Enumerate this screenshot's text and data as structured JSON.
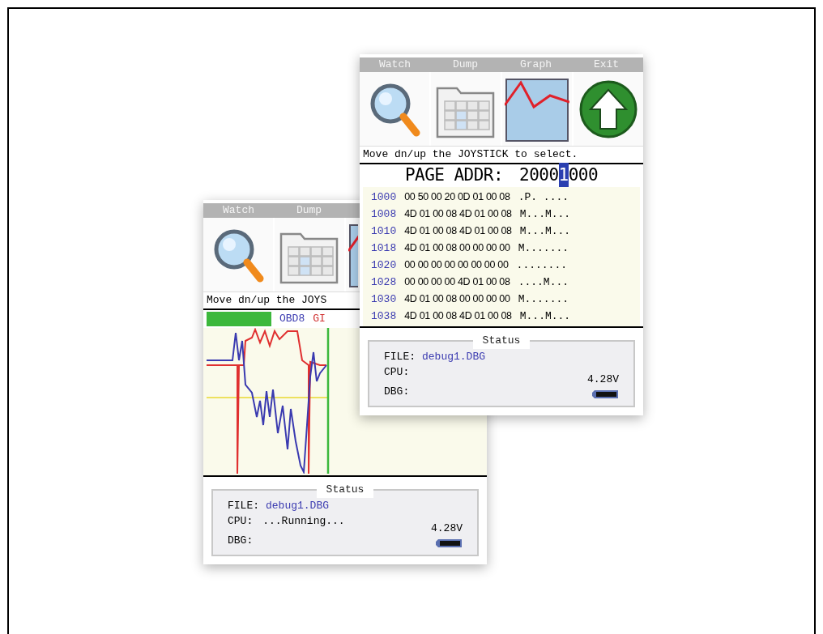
{
  "back_screen": {
    "menu": [
      "Watch",
      "Dump"
    ],
    "instruction": "Move dn/up the JOYS",
    "channels": [
      {
        "color": "#3cb83c"
      },
      {
        "label": "OBD8",
        "color": "#3a3ab0"
      },
      {
        "label": "GI",
        "color": "#d03030"
      }
    ],
    "status": {
      "title": "Status",
      "file_label": "FILE:",
      "file": "debug1.DBG",
      "cpu_label": "CPU:",
      "cpu": "...Running...",
      "dbg_label": "DBG:",
      "voltage": "4.28V"
    }
  },
  "front_screen": {
    "menu": [
      "Watch",
      "Dump",
      "Graph",
      "Exit"
    ],
    "instruction": "Move dn/up the JOYSTICK to select.",
    "page_addr": {
      "label": "PAGE ADDR:",
      "digits": [
        {
          "char": "2",
          "selected": false
        },
        {
          "char": "0",
          "selected": false
        },
        {
          "char": "0",
          "selected": false
        },
        {
          "char": "0",
          "selected": false
        },
        {
          "char": "1",
          "selected": true
        },
        {
          "char": "0",
          "selected": false
        },
        {
          "char": "0",
          "selected": false
        },
        {
          "char": "0",
          "selected": false
        }
      ]
    },
    "rows": [
      {
        "addr": "1000",
        "bytes": "00 50 00 20 0D 01 00 08",
        "ascii": ".P. ...."
      },
      {
        "addr": "1008",
        "bytes": "4D 01 00 08 4D 01 00 08",
        "ascii": "M...M..."
      },
      {
        "addr": "1010",
        "bytes": "4D 01 00 08 4D 01 00 08",
        "ascii": "M...M..."
      },
      {
        "addr": "1018",
        "bytes": "4D 01 00 08 00 00 00 00",
        "ascii": "M......."
      },
      {
        "addr": "1020",
        "bytes": "00 00 00 00 00 00 00 00",
        "ascii": "........"
      },
      {
        "addr": "1028",
        "bytes": "00 00 00 00 4D 01 00 08",
        "ascii": "....M..."
      },
      {
        "addr": "1030",
        "bytes": "4D 01 00 08 00 00 00 00",
        "ascii": "M......."
      },
      {
        "addr": "1038",
        "bytes": "4D 01 00 08 4D 01 00 08",
        "ascii": "M...M..."
      }
    ],
    "status": {
      "title": "Status",
      "file_label": "FILE:",
      "file": "debug1.DBG",
      "cpu_label": "CPU:",
      "dbg_label": "DBG:",
      "voltage": "4.28V"
    }
  }
}
